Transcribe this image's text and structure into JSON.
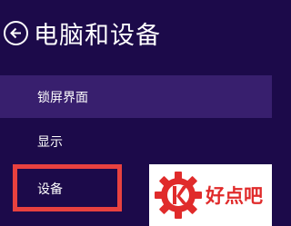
{
  "header": {
    "title": "电脑和设备",
    "back_icon": "back-arrow-icon"
  },
  "nav": {
    "items": [
      {
        "label": "锁屏界面",
        "selected": true
      },
      {
        "label": "显示",
        "selected": false
      },
      {
        "label": "设备",
        "selected": false,
        "highlighted": true
      }
    ]
  },
  "watermark": {
    "logo_icon": "gear-logo-icon",
    "text": "好点吧"
  },
  "colors": {
    "background": "#1c0a4a",
    "selected_item": "#381f6e",
    "highlight_box": "#e8413f",
    "watermark_red": "#e02b2b"
  }
}
